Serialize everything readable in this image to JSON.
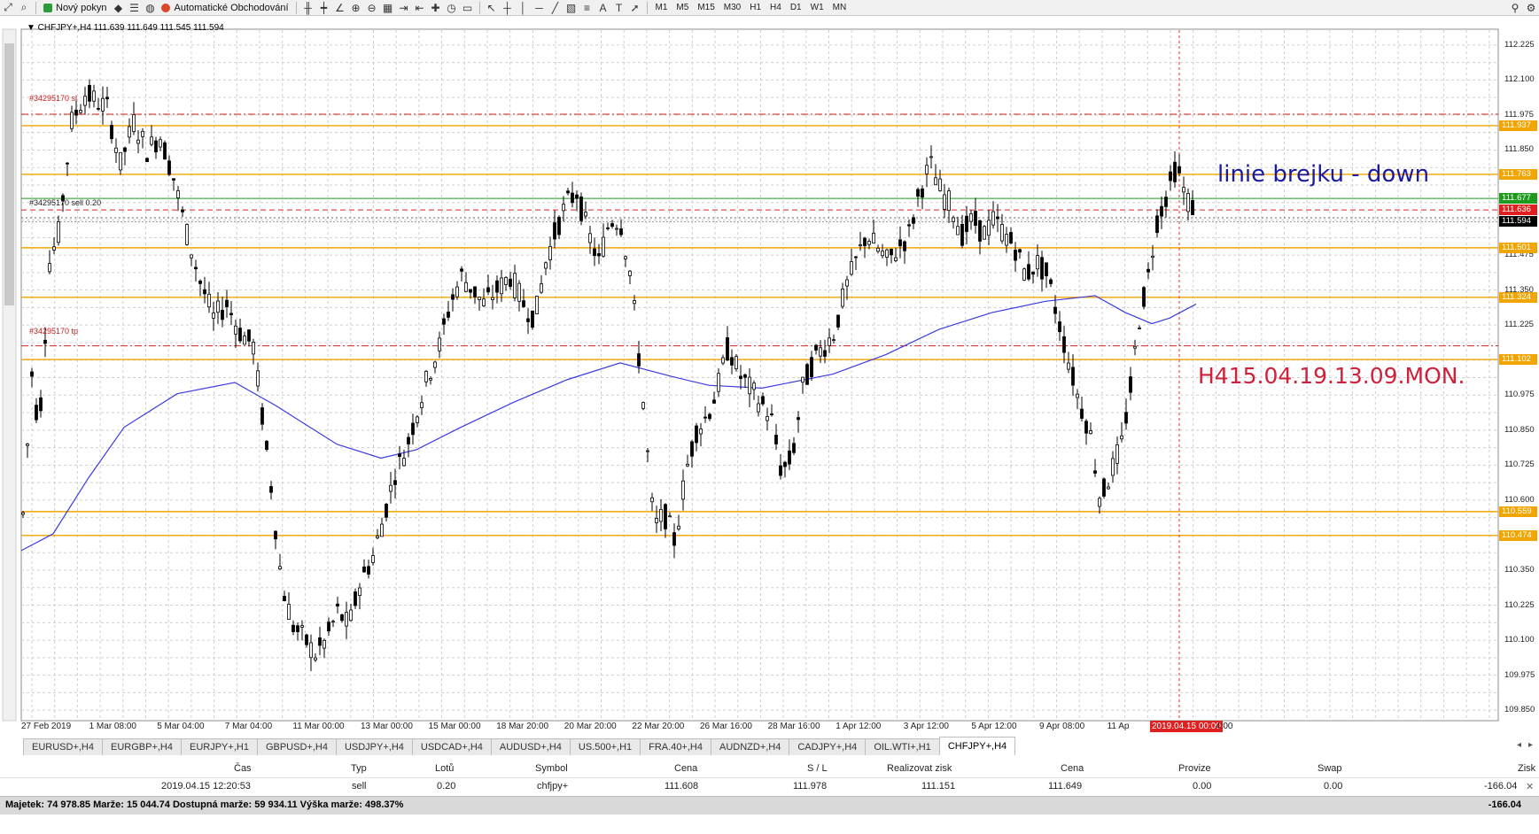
{
  "toolbar": {
    "new_order_label": "Nový pokyn",
    "auto_trading_label": "Automatické Obchodování",
    "timeframes": [
      "M1",
      "M5",
      "M15",
      "M30",
      "H1",
      "H4",
      "D1",
      "W1",
      "MN"
    ]
  },
  "chart": {
    "info_line": "▼ CHFJPY+,H4  111.639 111.649 111.545 111.594",
    "order_sl_label": "#34295170 sl",
    "order_sell_label": "#34295170 sell 0.20",
    "order_tp_label": "#34295170 tp",
    "annotation_breakout": "linie brejku - down",
    "annotation_timestamp": "H415.04.19.13.09.MON.",
    "breakout_color": "#1a1aa0",
    "timestamp_color": "#d0203a",
    "price_axis_labels": [
      "112.225",
      "112.100",
      "111.975",
      "111.850",
      "111.475",
      "111.350",
      "111.225",
      "110.975",
      "110.850",
      "110.725",
      "110.600",
      "110.350",
      "110.225",
      "110.100",
      "109.975",
      "109.850"
    ],
    "price_tags": [
      {
        "value": "111.937",
        "color": "#f0a500"
      },
      {
        "value": "111.763",
        "color": "#f0a500"
      },
      {
        "value": "111.677",
        "color": "#1e9a1e"
      },
      {
        "value": "111.636",
        "color": "#e02020"
      },
      {
        "value": "111.594",
        "color": "#000000"
      },
      {
        "value": "111.501",
        "color": "#f0a500"
      },
      {
        "value": "111.324",
        "color": "#f0a500"
      },
      {
        "value": "111.102",
        "color": "#f0a500"
      },
      {
        "value": "110.559",
        "color": "#f0a500"
      },
      {
        "value": "110.474",
        "color": "#f0a500"
      }
    ],
    "time_labels": [
      "27 Feb 2019",
      "1 Mar 08:00",
      "5 Mar 04:00",
      "7 Mar 04:00",
      "11 Mar 00:00",
      "13 Mar 00:00",
      "15 Mar 00:00",
      "18 Mar 20:00",
      "20 Mar 20:00",
      "22 Mar 20:00",
      "26 Mar 16:00",
      "28 Mar 16:00",
      "1 Apr 12:00",
      "3 Apr 12:00",
      "5 Apr 12:00",
      "9 Apr 08:00",
      "11 Ap"
    ],
    "time_cursor_label": "2019.04.15 00:00",
    "time_cursor_suffix": "4:00"
  },
  "tabs": [
    "EURUSD+,H4",
    "EURGBP+,H4",
    "EURJPY+,H1",
    "GBPUSD+,H4",
    "USDJPY+,H4",
    "USDCAD+,H4",
    "AUDUSD+,H4",
    "US.500+,H1",
    "FRA.40+,H4",
    "AUDNZD+,H4",
    "CADJPY+,H4",
    "OIL.WTI+,H1",
    "CHFJPY+,H4"
  ],
  "active_tab": "CHFJPY+,H4",
  "trade_table": {
    "headers": {
      "cas": "Čas",
      "typ": "Typ",
      "lotu": "Lotů",
      "symbol": "Symbol",
      "cena": "Cena",
      "sl": "S / L",
      "realizovat": "Realizovat zisk",
      "cena2": "Cena",
      "provize": "Provize",
      "swap": "Swap",
      "zisk": "Zisk"
    },
    "row": {
      "cas": "2019.04.15 12:20:53",
      "typ": "sell",
      "lotu": "0.20",
      "symbol": "chfjpy+",
      "cena": "111.608",
      "sl": "111.978",
      "realizovat": "111.151",
      "cena2": "111.649",
      "provize": "0.00",
      "swap": "0.00",
      "zisk": "-166.04"
    }
  },
  "status_bar": {
    "summary": "Majetek: 74 978.85  Marže: 15 044.74  Dostupná marže: 59 934.11  Výška marže: 498.37%",
    "total": "-166.04"
  },
  "colors": {
    "level_orange": "#f0a500",
    "ma_line": "#3b3be0",
    "grid": "#c9c9c9",
    "candle": "#000000"
  }
}
